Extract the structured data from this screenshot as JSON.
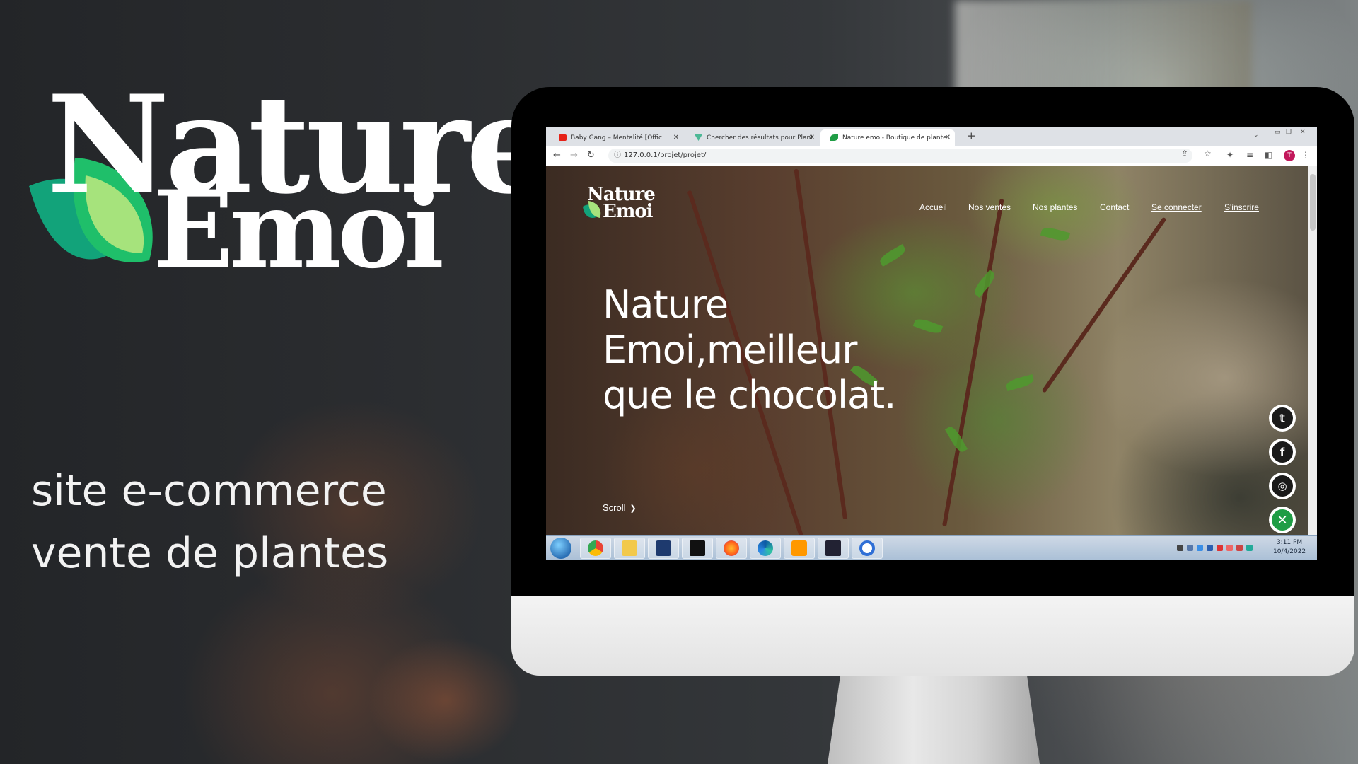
{
  "brand": {
    "line1": "Nature",
    "line2": "Emoi",
    "tagline_1": "site e-commerce",
    "tagline_2": "vente de plantes"
  },
  "browser": {
    "tabs": [
      {
        "title": "Baby Gang – Mentalité [Offic",
        "active": false
      },
      {
        "title": "Chercher des résultats pour Plant",
        "active": false
      },
      {
        "title": "Nature emoi- Boutique de plante",
        "active": true
      }
    ],
    "url": "127.0.0.1/projet/projet/"
  },
  "site": {
    "logo_line1": "Nature",
    "logo_line2": "Emoi",
    "nav": [
      "Accueil",
      "Nos ventes",
      "Nos plantes",
      "Contact",
      "Se connecter",
      "S'inscrire"
    ],
    "hero_line1": "Nature",
    "hero_line2": "Emoi,meilleur",
    "hero_line3": "que le chocolat.",
    "scroll_label": "Scroll",
    "social": [
      "twitter-icon",
      "facebook-icon",
      "instagram-icon",
      "close-icon"
    ]
  },
  "taskbar": {
    "apps": [
      "chrome-icon",
      "explorer-icon",
      "dev-icon",
      "terminal-icon",
      "firefox-icon",
      "edge-icon",
      "sublime-icon",
      "mysql-icon",
      "cortana-icon"
    ],
    "time": "3:11 PM",
    "date": "10/4/2022"
  },
  "colors": {
    "brand_green": "#1f9d45",
    "leaf_light": "#a6e37c",
    "leaf_teal": "#12a37a"
  }
}
